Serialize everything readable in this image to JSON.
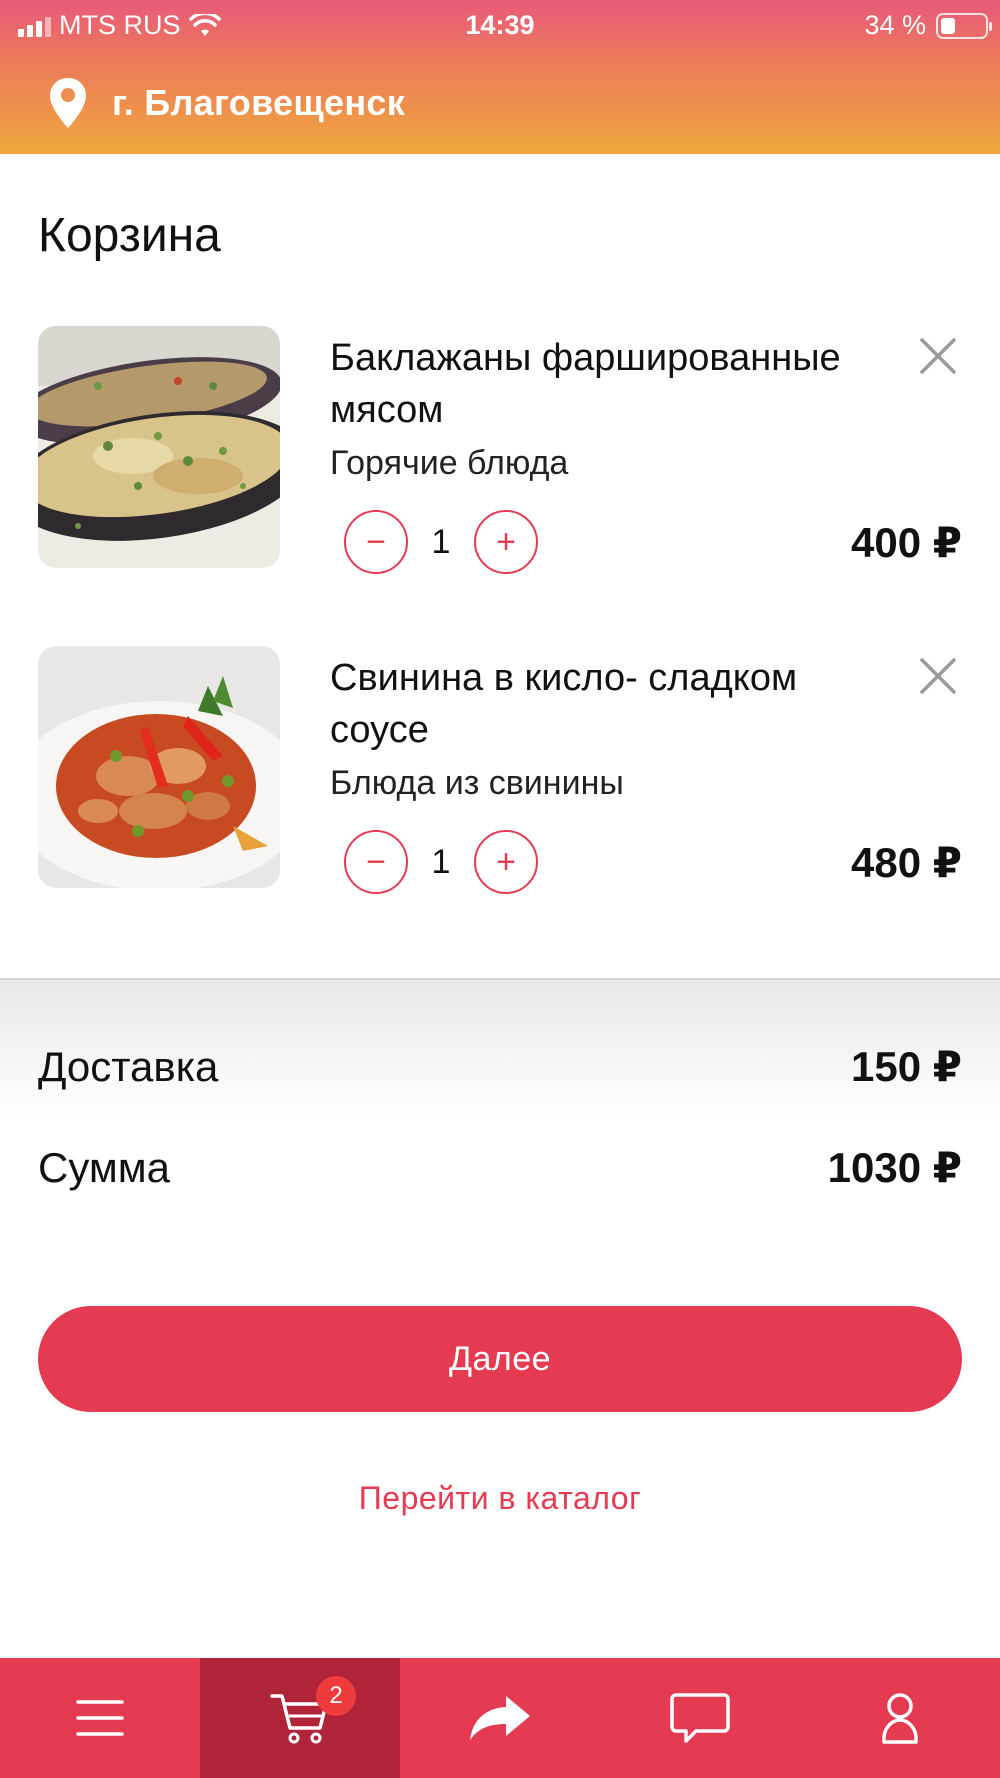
{
  "status_bar": {
    "carrier": "MTS RUS",
    "time": "14:39",
    "battery": "34 %",
    "battery_level": 0.34
  },
  "header": {
    "city": "г. Благовещенск"
  },
  "page": {
    "title": "Корзина"
  },
  "cart": {
    "items": [
      {
        "name": "Баклажаны фаршированные мясом",
        "category": "Горячие блюда",
        "quantity": "1",
        "price": "400 ₽"
      },
      {
        "name": "Свинина в кисло- сладком соусе",
        "category": "Блюда из свинины",
        "quantity": "1",
        "price": "480 ₽"
      }
    ],
    "minus_symbol": "−",
    "plus_symbol": "+"
  },
  "summary": {
    "delivery_label": "Доставка",
    "delivery_value": "150 ₽",
    "total_label": "Сумма",
    "total_value": "1030 ₽"
  },
  "actions": {
    "next_label": "Далее",
    "catalog_label": "Перейти в каталог"
  },
  "tabbar": {
    "tabs": [
      {
        "icon": "menu-icon"
      },
      {
        "icon": "cart-icon",
        "badge": "2",
        "active": true
      },
      {
        "icon": "share-icon"
      },
      {
        "icon": "chat-icon"
      },
      {
        "icon": "profile-icon"
      }
    ]
  },
  "colors": {
    "accent": "#e43a52",
    "tab_active": "#b0243a",
    "badge": "#ef3b3b"
  }
}
